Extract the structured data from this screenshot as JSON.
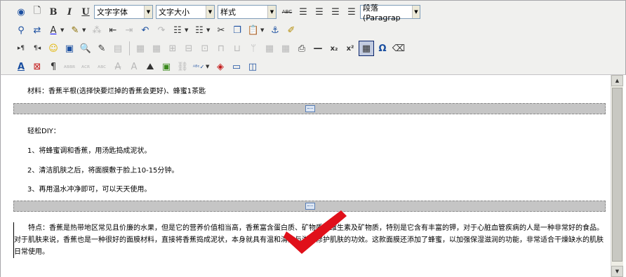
{
  "toolbar": {
    "font_family": "文字字体",
    "font_size": "文字大小",
    "style": "样式",
    "paragraph": "段落(Paragrap",
    "icons": [
      "help-icon",
      "new-document-icon",
      "bold",
      "italic",
      "underline",
      "strikethrough",
      "align-left",
      "align-center",
      "align-right",
      "align-justify",
      "find-icon",
      "replace-icon",
      "text-color",
      "highlight",
      "paste-word",
      "outdent",
      "indent",
      "undo",
      "redo",
      "bullet-list",
      "numbered-list",
      "cut",
      "copy",
      "paste",
      "anchor",
      "cleanup",
      "ltr",
      "rtl",
      "emoticon",
      "media",
      "preview",
      "edit-source",
      "template",
      "table",
      "table-props",
      "cell-props",
      "row-props",
      "col-props",
      "merge",
      "split",
      "form",
      "insert-layer",
      "print",
      "hr",
      "subscript",
      "superscript",
      "char-map",
      "omega",
      "eraser",
      "spellcheck",
      "pilcrow",
      "abbr",
      "acronym",
      "cite",
      "del",
      "ins",
      "image",
      "image-props",
      "link",
      "check-spelling",
      "remove-format",
      "fullscreen",
      "toggle-block"
    ],
    "labels": {
      "bold": "B",
      "italic": "I",
      "underline": "U",
      "abc": "ABC",
      "omega": "Ω",
      "sub": "x₂",
      "sup": "x²",
      "pilcrow": "¶"
    }
  },
  "content": {
    "line1": "材料：香蕉半根(选择快要烂掉的香蕉会更好)、蜂蜜1茶匙",
    "line2": "轻松DIY：",
    "line3": "1、将蜂蜜调和香蕉，用汤匙捣成泥状。",
    "line4": "2、清洁肌肤之后，将面膜敷于脸上10-15分钟。",
    "line5": "3、再用温水冲净即可，可以天天使用。",
    "para": "特点：香蕉是热带地区常见且价廉的水果，但是它的营养价值相当高，香蕉富含蛋白质、矿物质、维生素及矿物质，特别是它含有丰富的钾，对于心脏血管疾病的人是一种非常好的食品。对于肌肤来说，香蕉也是一种很好的面膜材料，直接将香蕉捣成泥状，本身就具有温和清洁与滋养修护肌肤的功效。这款面膜还添加了蜂蜜，以加强保湿滋润的功能，非常适合干燥缺水的肌肤日常使用。"
  },
  "colors": {
    "check": "#e0101a",
    "toolbar_bg": "#f0f0ee",
    "pagebreak": "#c5c5c5"
  }
}
